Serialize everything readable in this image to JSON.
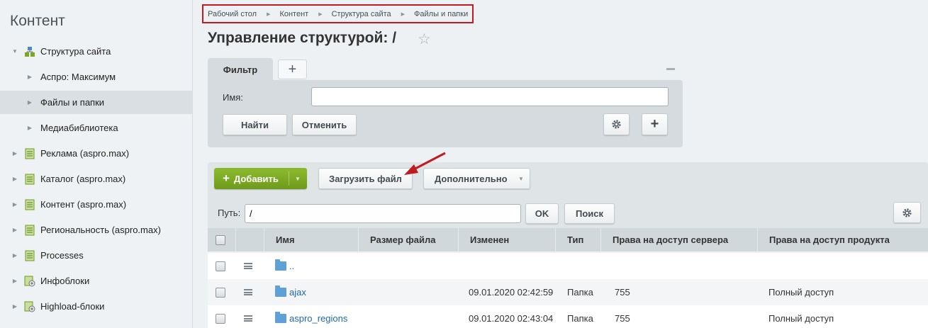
{
  "sidebar": {
    "title": "Контент",
    "items": [
      {
        "label": "Структура сайта",
        "expanded": true,
        "icon": "site-structure-icon"
      },
      {
        "label": "Аспро: Максимум",
        "icon": "none"
      },
      {
        "label": "Файлы и папки",
        "icon": "none",
        "active": true
      },
      {
        "label": "Медиабиблиотека",
        "icon": "none"
      },
      {
        "label": "Реклама (aspro.max)",
        "icon": "list-icon"
      },
      {
        "label": "Каталог (aspro.max)",
        "icon": "list-icon"
      },
      {
        "label": "Контент (aspro.max)",
        "icon": "list-icon"
      },
      {
        "label": "Региональность (aspro.max)",
        "icon": "list-icon"
      },
      {
        "label": "Processes",
        "icon": "list-icon"
      },
      {
        "label": "Инфоблоки",
        "icon": "infoblock-settings-icon"
      },
      {
        "label": "Highload-блоки",
        "icon": "infoblock-settings-icon"
      }
    ]
  },
  "breadcrumb": [
    "Рабочий стол",
    "Контент",
    "Структура сайта",
    "Файлы и папки"
  ],
  "page_title": "Управление структурой: /",
  "filter": {
    "tab_label": "Фильтр",
    "name_label": "Имя:",
    "name_value": "",
    "find_label": "Найти",
    "cancel_label": "Отменить"
  },
  "toolbar": {
    "add_label": "Добавить",
    "upload_label": "Загрузить файл",
    "more_label": "Дополнительно",
    "path_label": "Путь:",
    "path_value": "/",
    "ok_label": "OK",
    "search_label": "Поиск"
  },
  "table": {
    "columns": [
      "Имя",
      "Размер файла",
      "Изменен",
      "Тип",
      "Права на доступ сервера",
      "Права на доступ продукта"
    ],
    "rows": [
      {
        "name": "..",
        "size": "",
        "modified": "",
        "type": "",
        "server_rights": "",
        "product_rights": "",
        "icon": "folder-up-icon"
      },
      {
        "name": "ajax",
        "size": "",
        "modified": "09.01.2020 02:42:59",
        "type": "Папка",
        "server_rights": "755",
        "product_rights": "Полный доступ",
        "icon": "folder-icon"
      },
      {
        "name": "aspro_regions",
        "size": "",
        "modified": "09.01.2020 02:43:04",
        "type": "Папка",
        "server_rights": "755",
        "product_rights": "Полный доступ",
        "icon": "folder-icon"
      }
    ]
  },
  "colors": {
    "accent_green": "#7aa822",
    "annotation_red": "#c01a22",
    "link_blue": "#2067b0"
  }
}
